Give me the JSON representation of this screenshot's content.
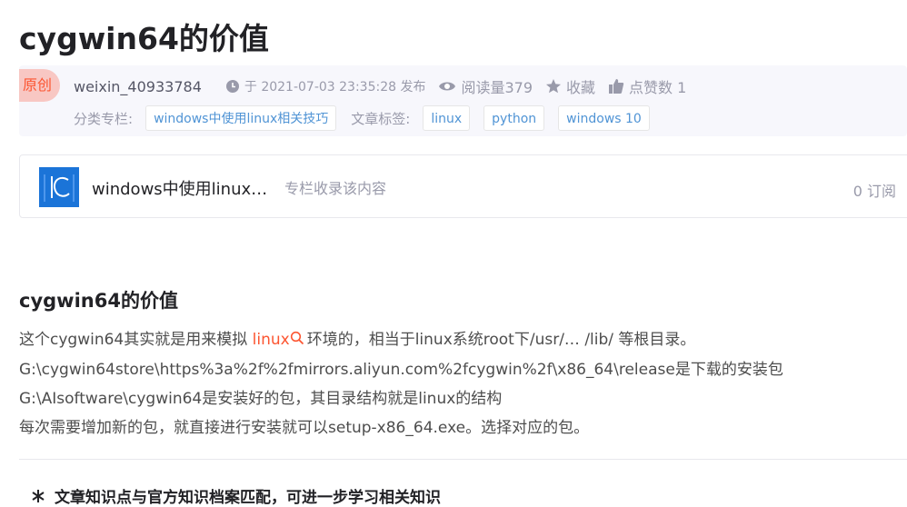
{
  "article": {
    "title": "cygwin64的价值",
    "badge": "原创",
    "author": "weixin_40933784",
    "publish_time": "于 2021-07-03 23:35:28 发布",
    "read_count": "阅读量379",
    "favorite_label": "收藏",
    "like_label": "点赞数 1",
    "category_label": "分类专栏:",
    "categories": [
      "windows中使用linux相关技巧"
    ],
    "tags_label": "文章标签:",
    "tags": [
      "linux",
      "python",
      "windows 10"
    ]
  },
  "column": {
    "name": "windows中使用linux…",
    "description": "专栏收录该内容",
    "subscribers": "0 订阅"
  },
  "content": {
    "heading": "cygwin64的价值",
    "line1_prefix": "这个cygwin64其实就是用来模拟 ",
    "line1_keyword": "linux",
    "line1_suffix": "环境的，相当于linux系统root下/usr/… /lib/ 等根目录。",
    "line2": "G:\\cygwin64store\\https%3a%2f%2fmirrors.aliyun.com%2fcygwin%2f\\x86_64\\release是下载的安装包",
    "line3": "G:\\AIsoftware\\cygwin64是安装好的包，其目录结构就是linux的结构",
    "line4": "每次需要增加新的包，就直接进行安装就可以setup-x86_64.exe。选择对应的包。"
  },
  "footer": {
    "knowledge_text": "文章知识点与官方知识档案匹配，可进一步学习相关知识"
  },
  "colors": {
    "accent": "#fc5531",
    "tag_text": "#5094d5",
    "muted": "#999aaa"
  },
  "icons": [
    "clock-icon",
    "eye-icon",
    "star-icon",
    "thumb-up-icon",
    "search-icon",
    "knowledge-icon"
  ]
}
